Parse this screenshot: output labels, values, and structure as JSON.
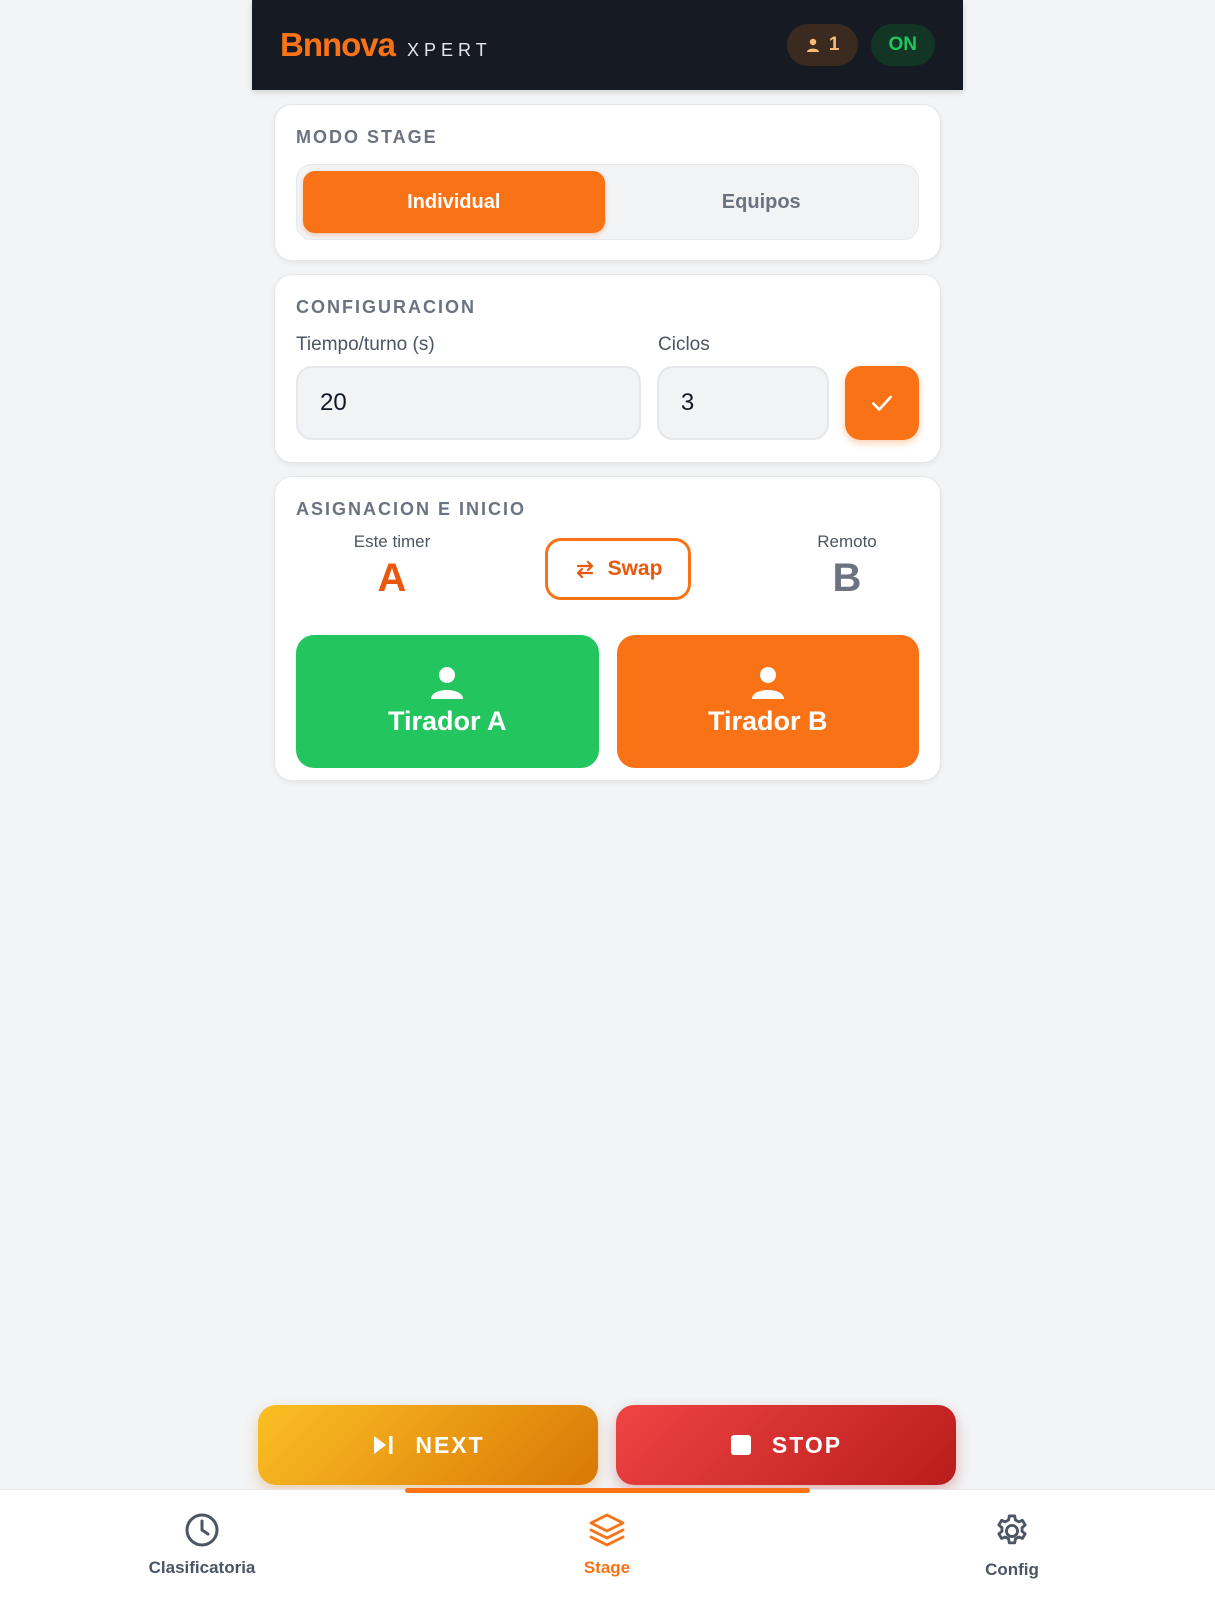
{
  "header": {
    "brand": "Bnnova",
    "brand_sub": "XPERT",
    "user_count": "1",
    "status": "ON",
    "icons": {
      "user": "user-icon"
    }
  },
  "mode_card": {
    "title": "MODO STAGE",
    "options": [
      {
        "label": "Individual",
        "active": true
      },
      {
        "label": "Equipos",
        "active": false
      }
    ]
  },
  "config_card": {
    "title": "CONFIGURACION",
    "time_label": "Tiempo/turno (s)",
    "time_value": "20",
    "cycles_label": "Ciclos",
    "cycles_value": "3",
    "confirm_icon": "check-icon"
  },
  "assign_card": {
    "title": "ASIGNACION E INICIO",
    "local_label": "Este timer",
    "local_letter": "A",
    "remote_label": "Remoto",
    "remote_letter": "B",
    "swap_label": "Swap",
    "swap_icon": "swap-arrows-icon",
    "shooter_a": "Tirador A",
    "shooter_b": "Tirador B",
    "shooter_icon": "person-icon"
  },
  "actions": {
    "next_label": "NEXT",
    "next_icon": "skip-next-icon",
    "stop_label": "STOP",
    "stop_icon": "stop-icon"
  },
  "nav": {
    "items": [
      {
        "label": "Clasificatoria",
        "icon": "clock-icon",
        "active": false
      },
      {
        "label": "Stage",
        "icon": "layers-icon",
        "active": true
      },
      {
        "label": "Config",
        "icon": "gear-icon",
        "active": false
      }
    ]
  },
  "colors": {
    "accent": "#f97316",
    "success": "#22c55e",
    "danger": "#dc2626",
    "warning": "#f59e0b",
    "header_bg": "#161a22",
    "page_bg": "#f2f4f6"
  }
}
